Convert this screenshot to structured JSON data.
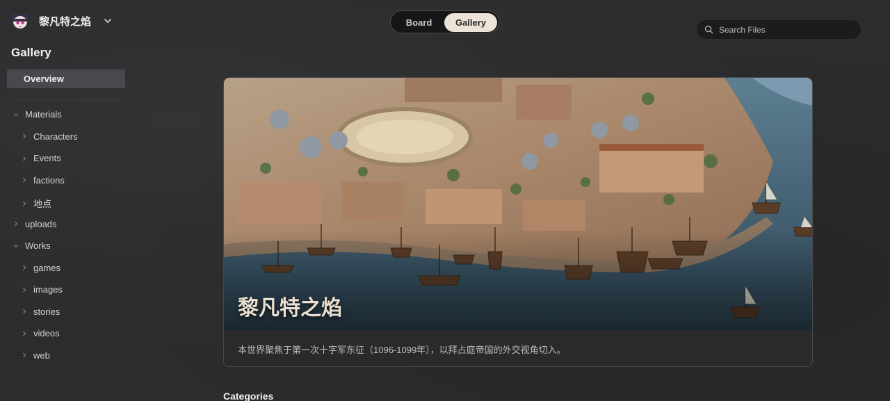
{
  "app": {
    "workspace_name": "黎凡特之焰",
    "logo_icon": "avatar-girl-icon"
  },
  "sidebar": {
    "title": "Gallery",
    "overview_label": "Overview",
    "tree": [
      {
        "label": "Materials",
        "expanded": true,
        "level": 0
      },
      {
        "label": "Characters",
        "expanded": false,
        "level": 1
      },
      {
        "label": "Events",
        "expanded": false,
        "level": 1
      },
      {
        "label": "factions",
        "expanded": false,
        "level": 1
      },
      {
        "label": "地点",
        "expanded": false,
        "level": 1
      },
      {
        "label": "uploads",
        "expanded": false,
        "level": 0
      },
      {
        "label": "Works",
        "expanded": true,
        "level": 0
      },
      {
        "label": "games",
        "expanded": false,
        "level": 1
      },
      {
        "label": "images",
        "expanded": false,
        "level": 1
      },
      {
        "label": "stories",
        "expanded": false,
        "level": 1
      },
      {
        "label": "videos",
        "expanded": false,
        "level": 1
      },
      {
        "label": "web",
        "expanded": false,
        "level": 1
      }
    ]
  },
  "tabs": {
    "board_label": "Board",
    "gallery_label": "Gallery",
    "active": "Gallery"
  },
  "search": {
    "placeholder": "Search Files"
  },
  "hero": {
    "title": "黎凡特之焰",
    "description": "本世界聚焦于第一次十字军东征（1096-1099年），以拜占庭帝国的外交视角切入。"
  },
  "sections": {
    "categories_label": "Categories"
  },
  "colors": {
    "background": "#2b2c2e",
    "active_tab": "#ede3d8",
    "sea": "#4d6f85"
  }
}
